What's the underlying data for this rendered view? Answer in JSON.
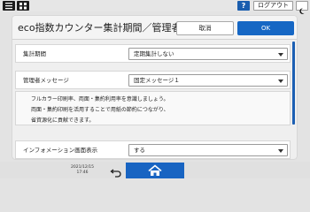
{
  "header": {
    "help_label": "?",
    "logout_label": "ログアウト"
  },
  "dialog": {
    "title": "eco指数カウンター集計期間／管理者メ...",
    "cancel_label": "取消",
    "ok_label": "OK"
  },
  "settings": [
    {
      "label": "集計期間",
      "value": "定期集計しない"
    },
    {
      "label": "管理者メッセージ",
      "value": "固定メッセージ１"
    }
  ],
  "message_lines": [
    "フルカラー印刷率、両面・集約利用率を意識しましょう。",
    "両面・集約印刷を活用することで用紙の節約につながり、",
    "省資源化に貢献できます。"
  ],
  "info_row": {
    "label": "インフォメーション画面表示",
    "value": "する"
  },
  "footer": {
    "date": "2021/12/15",
    "time": "17:46"
  },
  "colors": {
    "accent": "#1667c4",
    "home": "#1864c2"
  },
  "icons": [
    "menu-icon",
    "grid-icon",
    "help-icon",
    "moon-icon",
    "back-icon",
    "home-icon"
  ]
}
